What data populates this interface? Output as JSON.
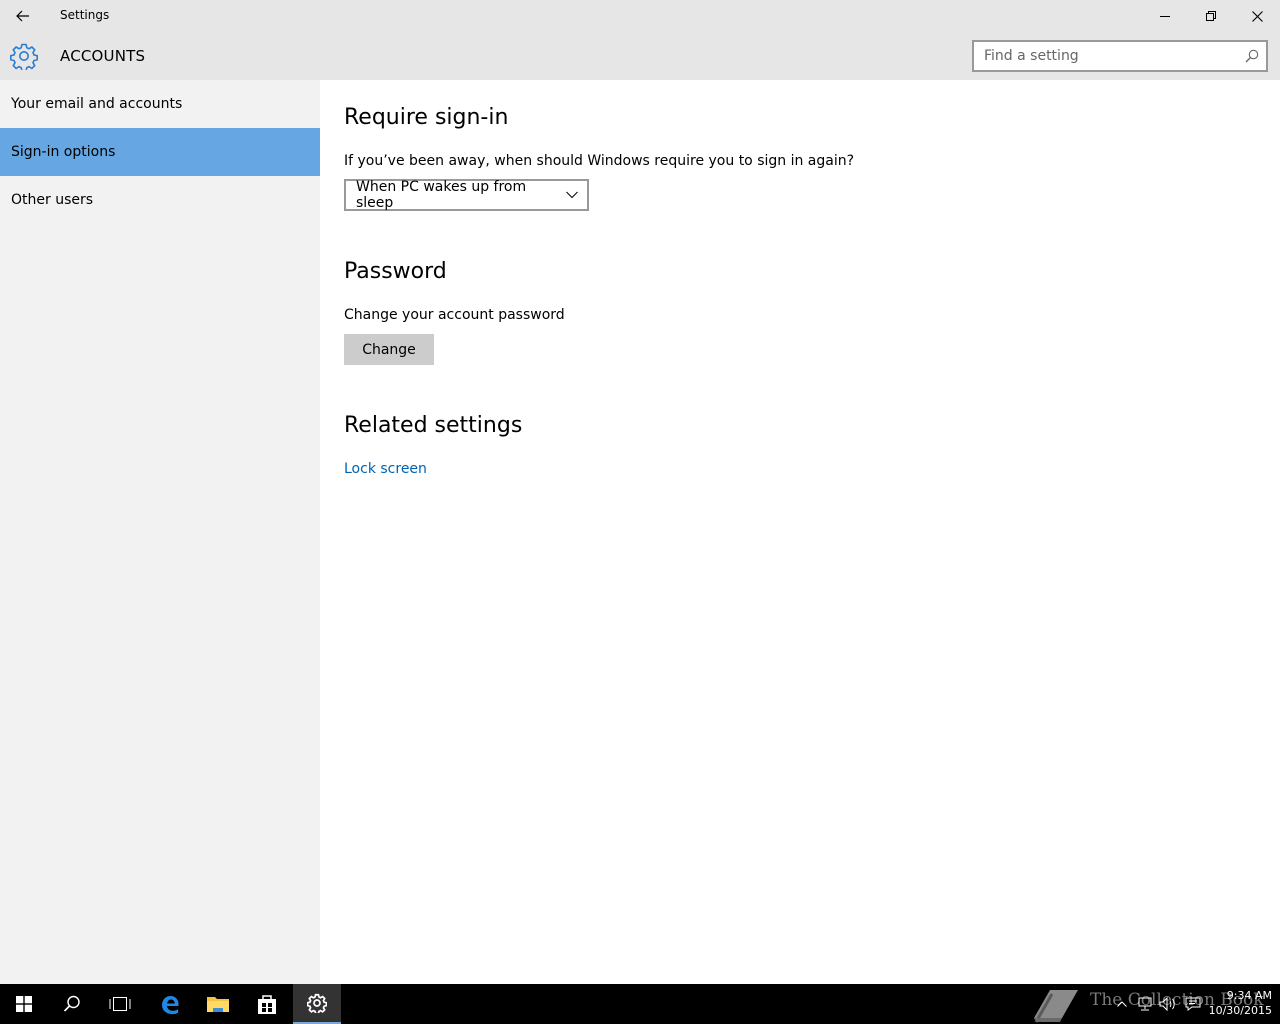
{
  "window": {
    "title": "Settings"
  },
  "header": {
    "section": "ACCOUNTS",
    "search_placeholder": "Find a setting"
  },
  "sidebar": {
    "items": [
      {
        "label": "Your email and accounts",
        "selected": false
      },
      {
        "label": "Sign-in options",
        "selected": true
      },
      {
        "label": "Other users",
        "selected": false
      }
    ]
  },
  "main": {
    "require_signin": {
      "title": "Require sign-in",
      "question": "If you’ve been away, when should Windows require you to sign in again?",
      "selected_option": "When PC wakes up from sleep"
    },
    "password": {
      "title": "Password",
      "description": "Change your account password",
      "button_label": "Change"
    },
    "related": {
      "title": "Related settings",
      "link": "Lock screen"
    }
  },
  "taskbar": {
    "watermark": "The Collection Book",
    "time": "9:34 AM",
    "date": "10/30/2015"
  },
  "colors": {
    "accent": "#0063b1",
    "selected_nav": "#66a7e3",
    "chrome": "#e6e6e6",
    "sidebar": "#f2f2f2"
  }
}
